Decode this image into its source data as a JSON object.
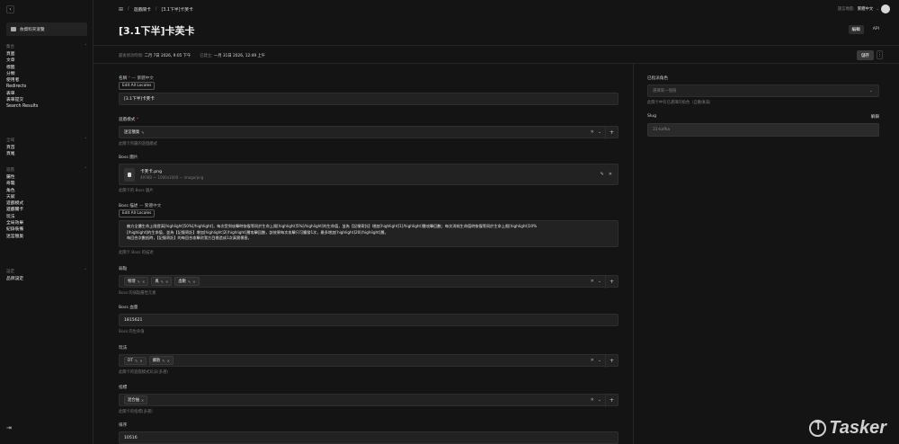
{
  "sidebar": {
    "collapse_icon": "‹",
    "folder_label": "依資料夾瀏覽",
    "groups": [
      {
        "title": "集合",
        "items": [
          "頁面",
          "文章",
          "標籤",
          "分類",
          "使用者",
          "Redirects",
          "表單",
          "表單提交",
          "Search Results"
        ]
      },
      {
        "title": "全域",
        "items": [
          "頁首",
          "頁尾"
        ]
      },
      {
        "title": "遊戲",
        "items": [
          "屬性",
          "奇襲",
          "角色",
          "天賦",
          "遊戲模式",
          "遊戲關卡",
          "玩法",
          "全局效果",
          "紀錄裝備",
          "迷宮獵巢"
        ]
      },
      {
        "title": "設定",
        "items": [
          "品牌設定"
        ]
      }
    ],
    "logout_icon": "⇥"
  },
  "header": {
    "breadcrumb": [
      "遊戲關卡",
      "[3.1下半]卡芙卡"
    ],
    "locale_label": "語言地區:",
    "locale_value": "繁體中文",
    "title": "[3.1下半]卡芙卡",
    "tabs": [
      "編輯",
      "API"
    ]
  },
  "meta": {
    "modified_label": "最後修改時間:",
    "modified_value": "二月 7日 2026, 9:05 下午",
    "created_label": "已建立:",
    "created_value": "一月 31日 2026, 12:49 上午",
    "save_label": "儲存",
    "more_icon": "⋮"
  },
  "form": {
    "name": {
      "label": "名稱",
      "locale": "— 繁體中文",
      "edit_locales": "Edit All Locales",
      "value": "[3.1下半]卡芙卡"
    },
    "mode": {
      "label": "遊戲模式",
      "chips": [
        "迷宮獵巢"
      ],
      "desc": "此關卡所屬的遊戲模式"
    },
    "boss_image": {
      "label": "Boss 圖片",
      "filename": "卡芙卡.png",
      "filemeta": "497KB — 1000x1000 — image/png",
      "desc": "此關卡的 Boss 圖片"
    },
    "boss_desc": {
      "label": "Boss 描述",
      "locale": "— 繁體中文",
      "edit_locales": "Edit All Locales",
      "lines": [
        "敵方全體生命上限提高[highlight]50%[/highlight]，每次受到攻擊時恢復等同於生命上限[highlight]5%[/highlight]的生命值，並為【記憶寄託】增加[highlight]1[/highlight]層攻擊回數；每次消耗生命值時恢復等同於生命上限[highlight]10%",
        "[/highlight]的生命值，並為【記憶寄託】增加[highlight]2[/highlight]層攻擊回數，該效果每次攻擊只可觸發1次，最多增加[highlight]20[/highlight]層。",
        "每回合次數抵時，【記憶寄託】的每回合攻擊對我方目標造成1次真實傷害。"
      ],
      "desc": "此關卡 Boss 的描述"
    },
    "weakness": {
      "label": "弱點",
      "chips": [
        "物理",
        "風",
        "虛數"
      ],
      "desc": "Boss 的弱點屬性元素"
    },
    "hp": {
      "label": "Boss 血量",
      "value": "1815621",
      "desc": "Boss 的生命值"
    },
    "gameplay": {
      "label": "玩法",
      "chips": [
        "DT",
        "擴散"
      ],
      "desc": "此關卡的遊戲模式玩法(多選)"
    },
    "tags": {
      "label": "指標",
      "chips": [
        "混合抽"
      ],
      "desc": "此關卡的指標(多選)"
    },
    "order": {
      "label": "排序",
      "value": "10516"
    }
  },
  "right": {
    "role_label": "已指派角色",
    "role_placeholder": "選擇第一個值",
    "role_desc": "此關卡中有已選擇的角色（自動填滿）",
    "slug_label": "Slug",
    "slug_action": "解鎖",
    "slug_value": "31-kafka"
  },
  "watermark": "Tasker"
}
